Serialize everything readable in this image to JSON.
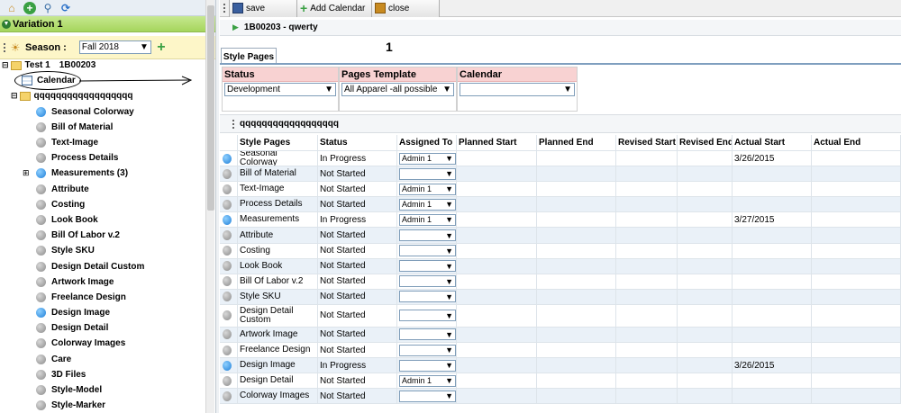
{
  "toolbar_left": {
    "icons": [
      "home-icon",
      "add-icon",
      "search-icon",
      "refresh-icon"
    ]
  },
  "variation": {
    "label": "Variation 1"
  },
  "season": {
    "label": "Season :",
    "value": "Fall 2018"
  },
  "tree": {
    "root_label": "Test 1",
    "root_code": "1B00203",
    "calendar_label": "Calendar",
    "folder_label": "qqqqqqqqqqqqqqqqqq",
    "items": [
      {
        "label": "Seasonal Colorway",
        "status": "blue"
      },
      {
        "label": "Bill of Material",
        "status": "gray"
      },
      {
        "label": "Text-Image",
        "status": "gray"
      },
      {
        "label": "Process Details",
        "status": "gray"
      },
      {
        "label": "Measurements (3)",
        "status": "blue"
      },
      {
        "label": "Attribute",
        "status": "gray"
      },
      {
        "label": "Costing",
        "status": "gray"
      },
      {
        "label": "Look Book",
        "status": "gray"
      },
      {
        "label": "Bill Of Labor v.2",
        "status": "gray"
      },
      {
        "label": "Style SKU",
        "status": "gray"
      },
      {
        "label": "Design Detail Custom",
        "status": "gray"
      },
      {
        "label": "Artwork Image",
        "status": "gray"
      },
      {
        "label": "Freelance Design",
        "status": "gray"
      },
      {
        "label": "Design Image",
        "status": "blue"
      },
      {
        "label": "Design Detail",
        "status": "gray"
      },
      {
        "label": "Colorway Images",
        "status": "gray"
      },
      {
        "label": "Care",
        "status": "gray"
      },
      {
        "label": "3D Files",
        "status": "gray"
      },
      {
        "label": "Style-Model",
        "status": "gray"
      },
      {
        "label": "Style-Marker",
        "status": "gray"
      }
    ]
  },
  "toolbar": {
    "save_label": "save",
    "add_calendar_label": "Add Calendar",
    "close_label": "close"
  },
  "breadcrumb": {
    "text": "1B00203 - qwerty"
  },
  "tabs": {
    "style_pages_label": "Style Pages",
    "number": "1"
  },
  "form": {
    "status_label": "Status",
    "status_value": "Development",
    "template_label": "Pages Template",
    "template_value": "All Apparel -all possible",
    "calendar_label": "Calendar",
    "calendar_value": ""
  },
  "section": {
    "title": "qqqqqqqqqqqqqqqqqq"
  },
  "grid": {
    "headers": [
      "Style Pages",
      "Status",
      "Assigned To",
      "Planned Start",
      "Planned End",
      "Revised Start",
      "Revised End",
      "Actual Start",
      "Actual End"
    ],
    "rows": [
      {
        "page": "Seasonal Colorway",
        "status": "In Progress",
        "assigned": "Admin 1",
        "actual_start": "3/26/2015",
        "dot": "blue"
      },
      {
        "page": "Bill of Material",
        "status": "Not Started",
        "assigned": "",
        "actual_start": "",
        "dot": "gray"
      },
      {
        "page": "Text-Image",
        "status": "Not Started",
        "assigned": "Admin 1",
        "actual_start": "",
        "dot": "gray"
      },
      {
        "page": "Process Details",
        "status": "Not Started",
        "assigned": "Admin 1",
        "actual_start": "",
        "dot": "gray"
      },
      {
        "page": "Measurements",
        "status": "In Progress",
        "assigned": "Admin 1",
        "actual_start": "3/27/2015",
        "dot": "blue"
      },
      {
        "page": "Attribute",
        "status": "Not Started",
        "assigned": "",
        "actual_start": "",
        "dot": "gray"
      },
      {
        "page": "Costing",
        "status": "Not Started",
        "assigned": "",
        "actual_start": "",
        "dot": "gray"
      },
      {
        "page": "Look Book",
        "status": "Not Started",
        "assigned": "",
        "actual_start": "",
        "dot": "gray"
      },
      {
        "page": "Bill Of Labor v.2",
        "status": "Not Started",
        "assigned": "",
        "actual_start": "",
        "dot": "gray"
      },
      {
        "page": "Style SKU",
        "status": "Not Started",
        "assigned": "",
        "actual_start": "",
        "dot": "gray"
      },
      {
        "page": "Design Detail Custom",
        "status": "Not Started",
        "assigned": "",
        "actual_start": "",
        "dot": "gray"
      },
      {
        "page": "Artwork Image",
        "status": "Not Started",
        "assigned": "",
        "actual_start": "",
        "dot": "gray"
      },
      {
        "page": "Freelance Design",
        "status": "Not Started",
        "assigned": "",
        "actual_start": "",
        "dot": "gray"
      },
      {
        "page": "Design Image",
        "status": "In Progress",
        "assigned": "",
        "actual_start": "3/26/2015",
        "dot": "blue"
      },
      {
        "page": "Design Detail",
        "status": "Not Started",
        "assigned": "Admin 1",
        "actual_start": "",
        "dot": "gray"
      },
      {
        "page": "Colorway Images",
        "status": "Not Started",
        "assigned": "",
        "actual_start": "",
        "dot": "gray"
      }
    ]
  },
  "colors": {
    "variation_bar": "#a5d55c",
    "season_bar": "#fdf6c8",
    "status_header": "#f8d2d2",
    "row_alt": "#eaf1f8",
    "dot_blue": "#1f7fd8"
  }
}
